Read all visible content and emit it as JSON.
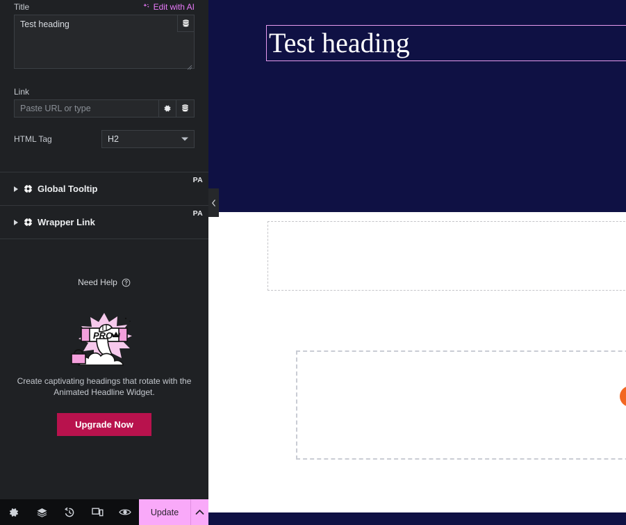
{
  "panel": {
    "title_field": {
      "label": "Title",
      "ai_button": "Edit with AI",
      "ai_icon": "sparkles-icon",
      "value": "Test heading",
      "dynamic_icon": "database-stack-icon"
    },
    "link_field": {
      "label": "Link",
      "value": "",
      "placeholder": "Paste URL or type",
      "options_icon": "gear-icon",
      "dynamic_icon": "database-stack-icon"
    },
    "html_tag": {
      "label": "HTML Tag",
      "value": "H2",
      "caret_icon": "chevron-down-icon"
    },
    "sections": [
      {
        "title": "Global Tooltip",
        "badge": "PA",
        "icon": "pa-gear-icon",
        "arrow": "triangle-right-icon"
      },
      {
        "title": "Wrapper Link",
        "badge": "PA",
        "icon": "pa-gear-icon",
        "arrow": "triangle-right-icon"
      }
    ],
    "need_help": {
      "label": "Need Help",
      "icon": "question-circle-icon"
    },
    "promo": {
      "art": "pro-character-banner-illustration",
      "text": "Create captivating headings that rotate with the Animated Headline Widget.",
      "button": "Upgrade Now",
      "button_color": "#b8124d"
    },
    "collapse_handle": {
      "icon": "chevron-left-icon"
    }
  },
  "bottom_bar": {
    "icons": [
      {
        "name": "settings-gear-icon"
      },
      {
        "name": "layers-navigator-icon"
      },
      {
        "name": "history-clock-icon"
      },
      {
        "name": "responsive-mode-icon"
      },
      {
        "name": "preview-eye-icon"
      }
    ],
    "update_label": "Update",
    "update_caret_icon": "chevron-up-icon",
    "update_color": "#f9a9f9"
  },
  "canvas": {
    "hero_background": "#0f1144",
    "heading": "Test heading",
    "selection_color": "#e79cf0",
    "empty_container_1": "",
    "empty_container_2": "",
    "chat_bubble_color": "#f26722"
  }
}
